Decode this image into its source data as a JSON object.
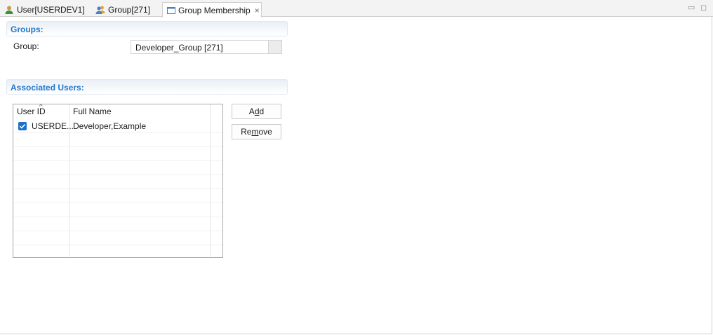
{
  "tabs": [
    {
      "label": "User[USERDEV1]",
      "icon": "user-icon"
    },
    {
      "label": "Group[271]",
      "icon": "group-icon"
    },
    {
      "label": "Group Membership",
      "icon": "form-icon",
      "close": "×",
      "active": true
    }
  ],
  "window_controls": {
    "minimize": "▭",
    "maximize": "◻"
  },
  "groups_section": {
    "title": "Groups:",
    "group_label": "Group:",
    "group_value": "Developer_Group [271]"
  },
  "users_section": {
    "title": "Associated Users:",
    "columns": [
      "User ID",
      "Full Name"
    ],
    "sort_indicator": "^",
    "rows": [
      {
        "user_id": "USERDE...",
        "full_name": "Developer,Example",
        "checked": true
      }
    ]
  },
  "buttons": {
    "add": {
      "pre": "A",
      "mnemonic": "d",
      "post": "d"
    },
    "remove": {
      "pre": "Re",
      "mnemonic": "m",
      "post": "ove"
    }
  },
  "colors": {
    "accent": "#1f78c9",
    "checkbox": "#1a73c9"
  }
}
